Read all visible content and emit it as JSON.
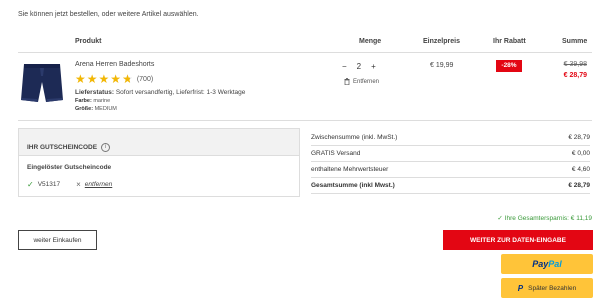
{
  "intro_text": "Sie können jetzt bestellen, oder weitere Artikel auswählen.",
  "table": {
    "headers": {
      "product": "Produkt",
      "quantity": "Menge",
      "unit_price": "Einzelpreis",
      "discount": "Ihr Rabatt",
      "total": "Summe"
    }
  },
  "item": {
    "name": "Arena Herren Badeshorts",
    "rating": 4.7,
    "rating_count": "(700)",
    "delivery_label": "Lieferstatus:",
    "delivery_value": "Sofort versandfertig, Lieferfrist: 1-3 Werktage",
    "color_label": "Farbe:",
    "color_value": "marine",
    "size_label": "Größe:",
    "size_value": "MEDIUM",
    "minus": "−",
    "quantity": "2",
    "plus": "+",
    "remove_label": "Entfernen",
    "unit_price": "€ 19,99",
    "discount": "-28%",
    "old_total": "€ 39,98",
    "new_total": "€ 28,79"
  },
  "voucher": {
    "header": "IHR GUTSCHEINCODE",
    "redeemed_label": "Eingelöster Gutscheincode",
    "code": "V51317",
    "remove_label": "entfernen"
  },
  "summary": [
    {
      "label": "Zwischensumme (inkl. MwSt.)",
      "value": "€ 28,79",
      "bold": false
    },
    {
      "label": "GRATIS Versand",
      "value": "€ 0,00",
      "bold": false
    },
    {
      "label": "enthaltene Mehrwertsteuer",
      "value": "€ 4,60",
      "bold": false
    },
    {
      "label": "Gesamtsumme (inkl Mwst.)",
      "value": "€ 28,79",
      "bold": true
    }
  ],
  "savings_text": "Ihre Gesamtersparnis: € 11,19",
  "buttons": {
    "continue": "weiter Einkaufen",
    "next": "WEITER ZUR DATEN-EINGABE",
    "paypal_a": "Pay",
    "paypal_b": "Pal",
    "pay_later": "Später Bezahlen"
  },
  "colors": {
    "accent": "#e30613",
    "paypal_yellow": "#ffc439",
    "success": "#3a9a3a"
  }
}
